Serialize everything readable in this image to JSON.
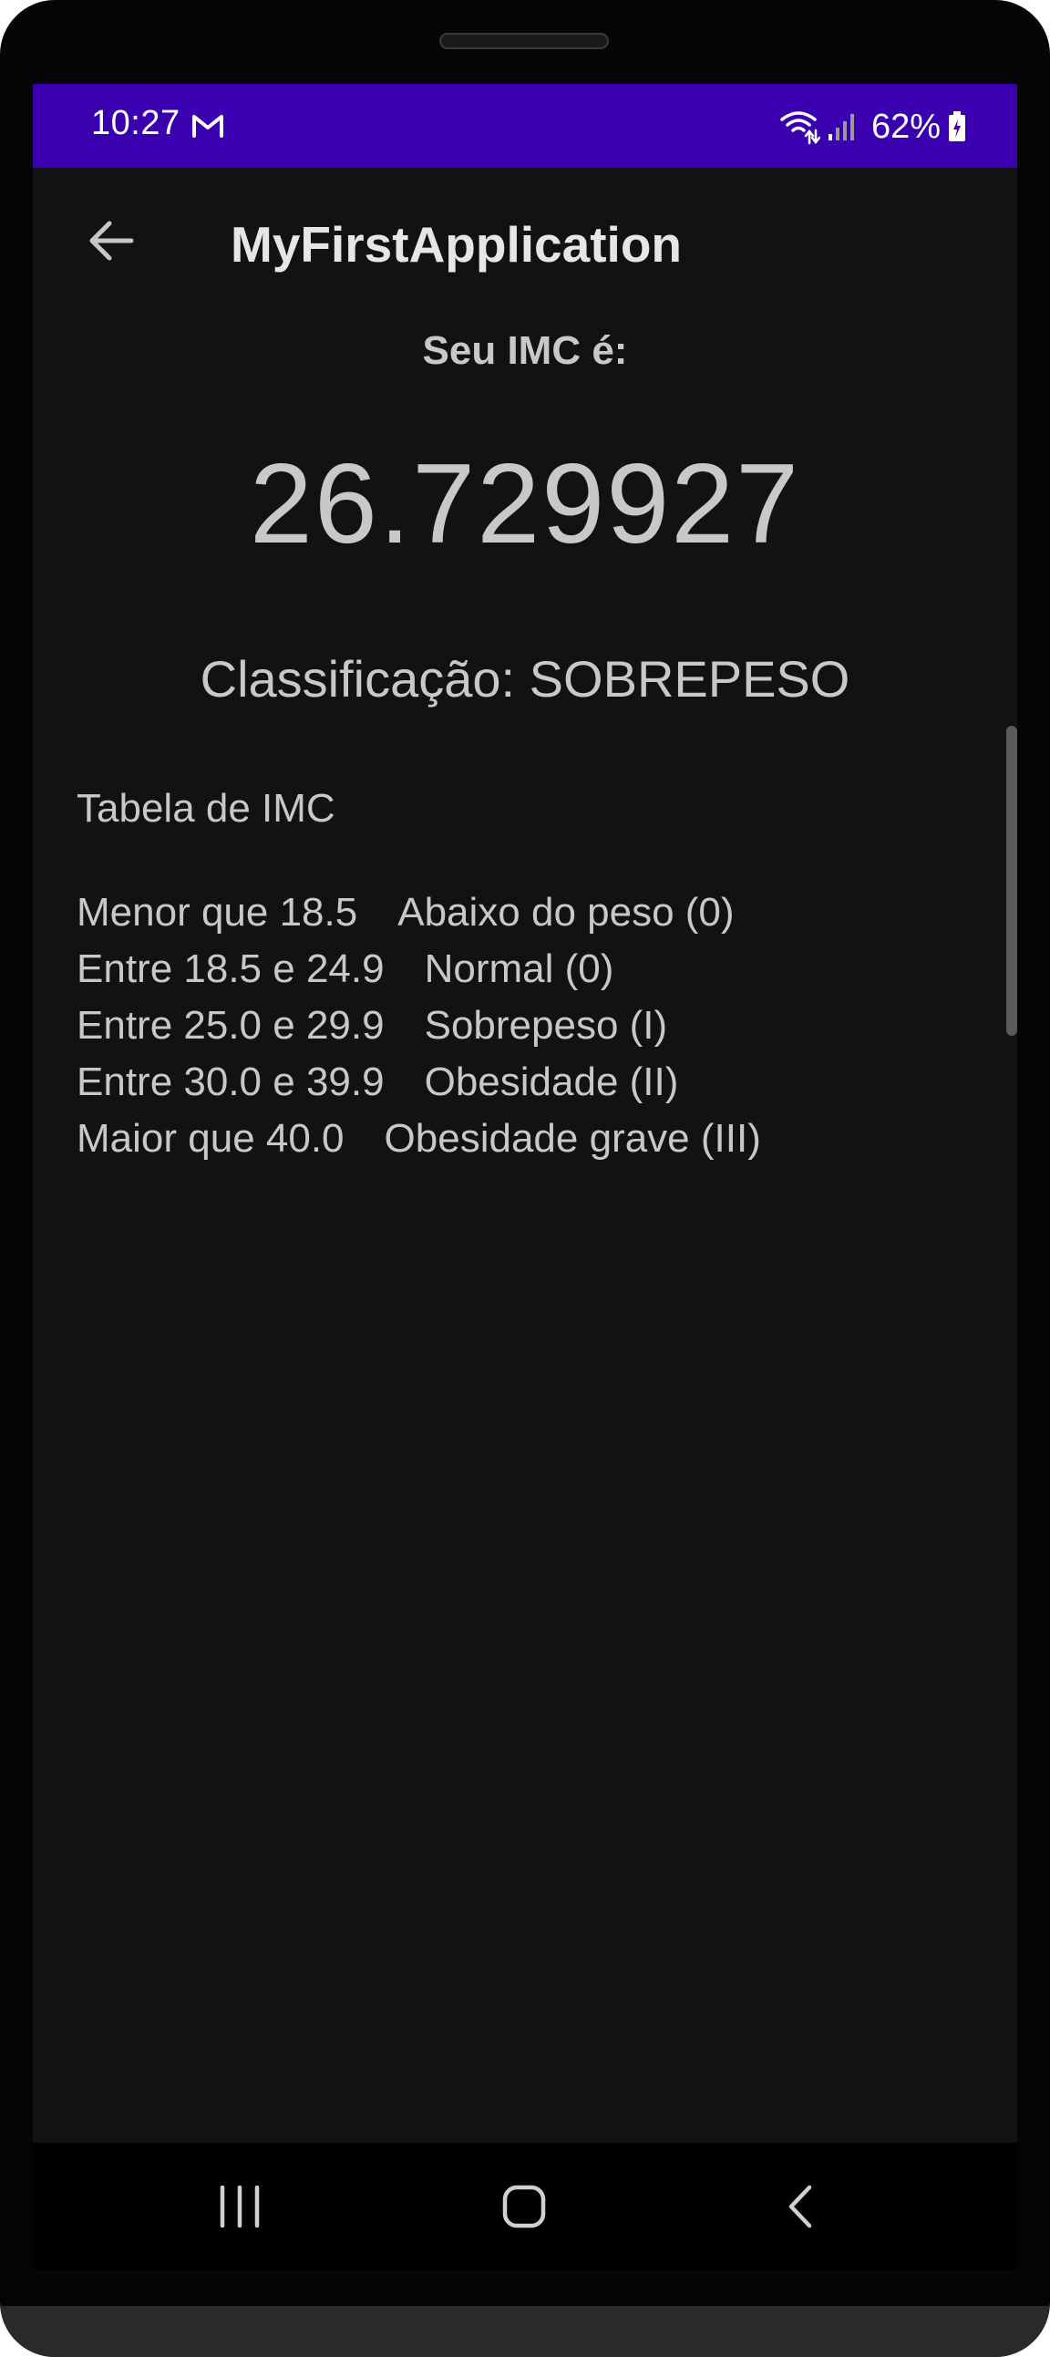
{
  "status_bar": {
    "time": "10:27",
    "notification_icon": "gmail-icon",
    "wifi_icon": "wifi-icon",
    "signal_icon": "signal-icon",
    "battery_percent": "62%",
    "battery_icon": "battery-charging-icon",
    "background_color": "#3a00b0"
  },
  "app_bar": {
    "back_icon": "arrow-back-icon",
    "title": "MyFirstApplication"
  },
  "result": {
    "label": "Seu IMC é:",
    "value": "26.729927",
    "classification": "Classificação: SOBREPESO"
  },
  "imc_table": {
    "title": "Tabela de IMC",
    "rows": [
      {
        "range": "Menor que 18.5",
        "category": "Abaixo do peso (0)"
      },
      {
        "range": "Entre 18.5 e 24.9",
        "category": "Normal (0)"
      },
      {
        "range": "Entre 25.0 e 29.9",
        "category": "Sobrepeso (I)"
      },
      {
        "range": "Entre 30.0 e 39.9",
        "category": "Obesidade (II)"
      },
      {
        "range": "Maior que 40.0",
        "category": "Obesidade grave (III)"
      }
    ]
  },
  "nav_bar": {
    "recents_icon": "recents-icon",
    "home_icon": "home-icon",
    "back_icon": "nav-back-icon"
  }
}
